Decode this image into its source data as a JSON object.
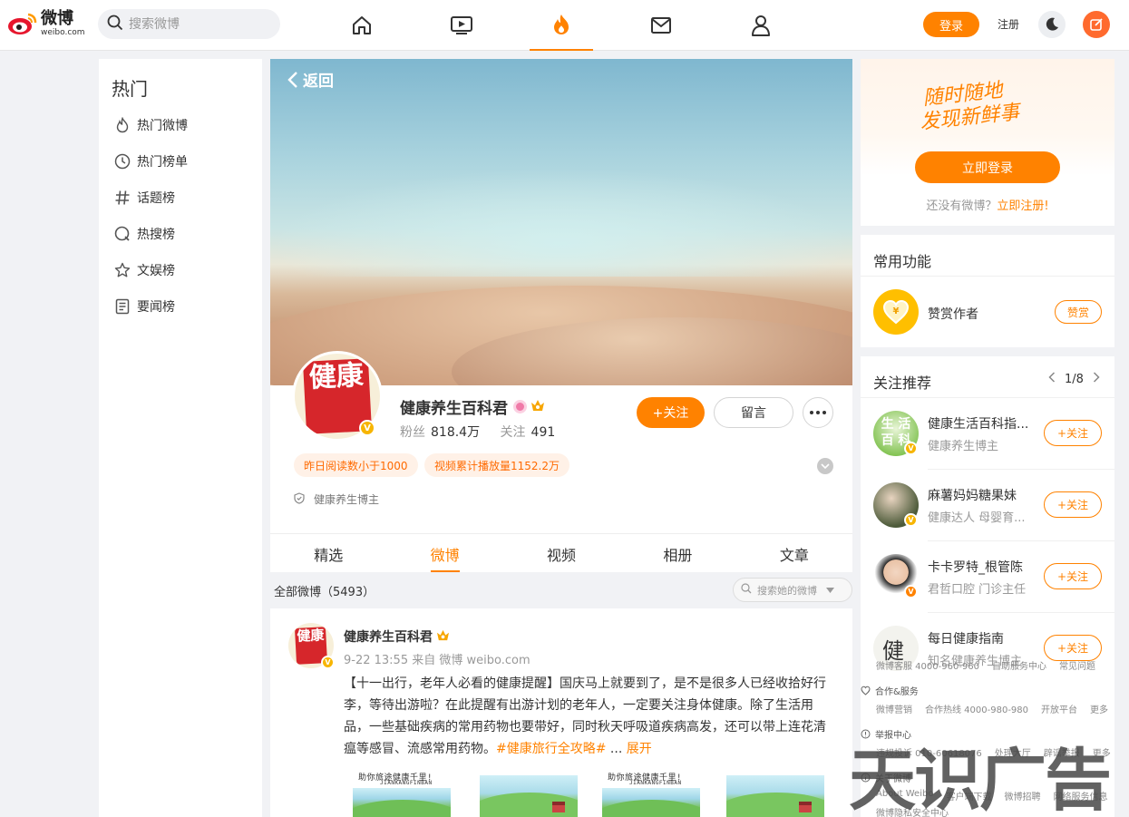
{
  "topbar": {
    "logo_cn": "微博",
    "logo_en": "weibo.com",
    "search_placeholder": "搜索微博",
    "nav_icons": [
      "home-icon",
      "video-icon",
      "hot-fire-icon",
      "mail-icon",
      "user-icon"
    ],
    "login_label": "登录",
    "register_label": "注册"
  },
  "sidebar": {
    "title": "热门",
    "items": [
      {
        "label": "热门微博",
        "icon": "fire-icon"
      },
      {
        "label": "热门榜单",
        "icon": "clock-icon"
      },
      {
        "label": "话题榜",
        "icon": "hash-icon"
      },
      {
        "label": "热搜榜",
        "icon": "search-circle-icon"
      },
      {
        "label": "文娱榜",
        "icon": "star-icon"
      },
      {
        "label": "要闻榜",
        "icon": "news-icon"
      }
    ]
  },
  "profile": {
    "back_label": "返回",
    "avatar_text": "健康",
    "name": "健康养生百科君",
    "fans_label": "粉丝",
    "fans_value": "818.4万",
    "follow_label": "关注",
    "follow_value": "491",
    "follow_button": "+关注",
    "message_button": "留言",
    "tags": [
      "昨日阅读数小于1000",
      "视频累计播放量1152.2万"
    ],
    "description": "健康养生博主"
  },
  "tabs": [
    {
      "label": "精选",
      "active": false
    },
    {
      "label": "微博",
      "active": true
    },
    {
      "label": "视频",
      "active": false
    },
    {
      "label": "相册",
      "active": false
    },
    {
      "label": "文章",
      "active": false
    }
  ],
  "posts_header": {
    "all_label": "全部微博（5493）",
    "search_placeholder": "搜索她的微博"
  },
  "post": {
    "author": "健康养生百科君",
    "meta": "9-22 13:55  来自 微博 weibo.com",
    "text": "【十一出行，老年人必看的健康提醒】国庆马上就要到了，是不是很多人已经收拾好行李，等待出游啦？在此提醒有出游计划的老年人，一定要关注身体健康。除了生活用品，一些基础疾病的常用药物也要带好，同时秋天呼吸道疾病高发，还可以带上连花清瘟等感冒、流感常用药物。",
    "hashtag": "#健康旅行全攻略#",
    "ellipsis": " ... ",
    "expand": "展开",
    "thumb_caption": "助你旅途健康千里!",
    "thumb_subcaption": "JIANKANGFINBAN"
  },
  "login_card": {
    "slogan_line1": "随时随地",
    "slogan_line2": "发现新鲜事",
    "login_button": "立即登录",
    "no_account": "还没有微博？",
    "register_link": "立即注册!"
  },
  "functions": {
    "title": "常用功能",
    "reward_label": "赞赏作者",
    "reward_button": "赞赏"
  },
  "recommend": {
    "title": "关注推荐",
    "page": "1/8",
    "follow_button": "+关注",
    "items": [
      {
        "name": "健康生活百科指...",
        "desc": "健康养生博主"
      },
      {
        "name": "麻薯妈妈糖果妹",
        "desc": "健康达人 母婴育..."
      },
      {
        "name": "卡卡罗特_根管陈",
        "desc": "君哲口腔 门诊主任"
      },
      {
        "name": "每日健康指南",
        "desc": "知名健康养生博主"
      }
    ]
  },
  "footer": {
    "row0": [
      "微博客服 4000-960-960",
      "自助服务中心",
      "常见问题"
    ],
    "sec1_title": "合作&服务",
    "sec1_links": [
      "微博营销",
      "合作热线 4000-980-980",
      "开放平台",
      "更多"
    ],
    "sec2_title": "举报中心",
    "sec2_links": [
      "违规投诉 010-60618076",
      "处理大厅",
      "辟谣举报",
      "更多"
    ],
    "sec3_title": "关于微博",
    "sec3_links": [
      "About Weibo",
      "客户端下载",
      "微博招聘",
      "网络服务信息"
    ],
    "sec3_more": "微博隐私安全中心"
  },
  "watermark": "天识广告",
  "colors": {
    "accent": "#ff8200",
    "badge": "#f7b500",
    "seal_red": "#d6262b"
  }
}
